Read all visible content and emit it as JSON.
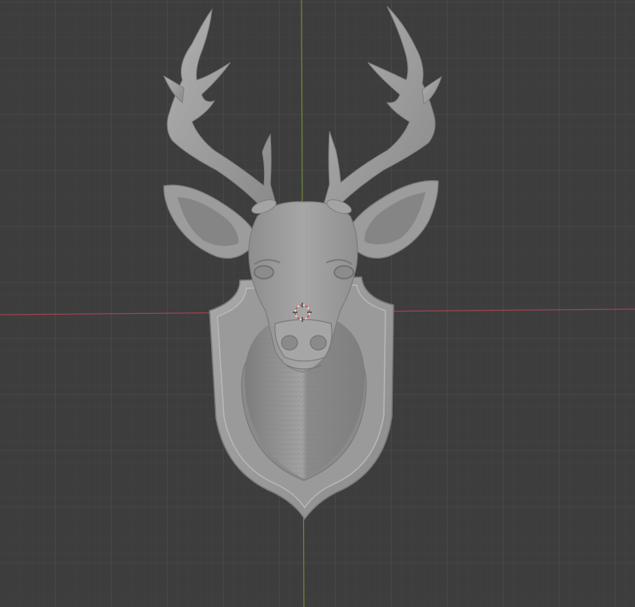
{
  "viewport": {
    "background_color": "#3d3d3d",
    "grid_minor_color": "#454545",
    "grid_major_color": "#4a4a4a",
    "x_axis_color": "#a8454f",
    "y_axis_color": "#71893a",
    "model_base_color": "#9e9e9e",
    "model_shadow_color": "#7a7a7a",
    "model_highlight_color": "#c4c4c4",
    "cursor_color": "#e05050"
  },
  "scene": {
    "model_name": "deer-head-trophy",
    "cursor_icon": "3d-cursor-icon"
  }
}
